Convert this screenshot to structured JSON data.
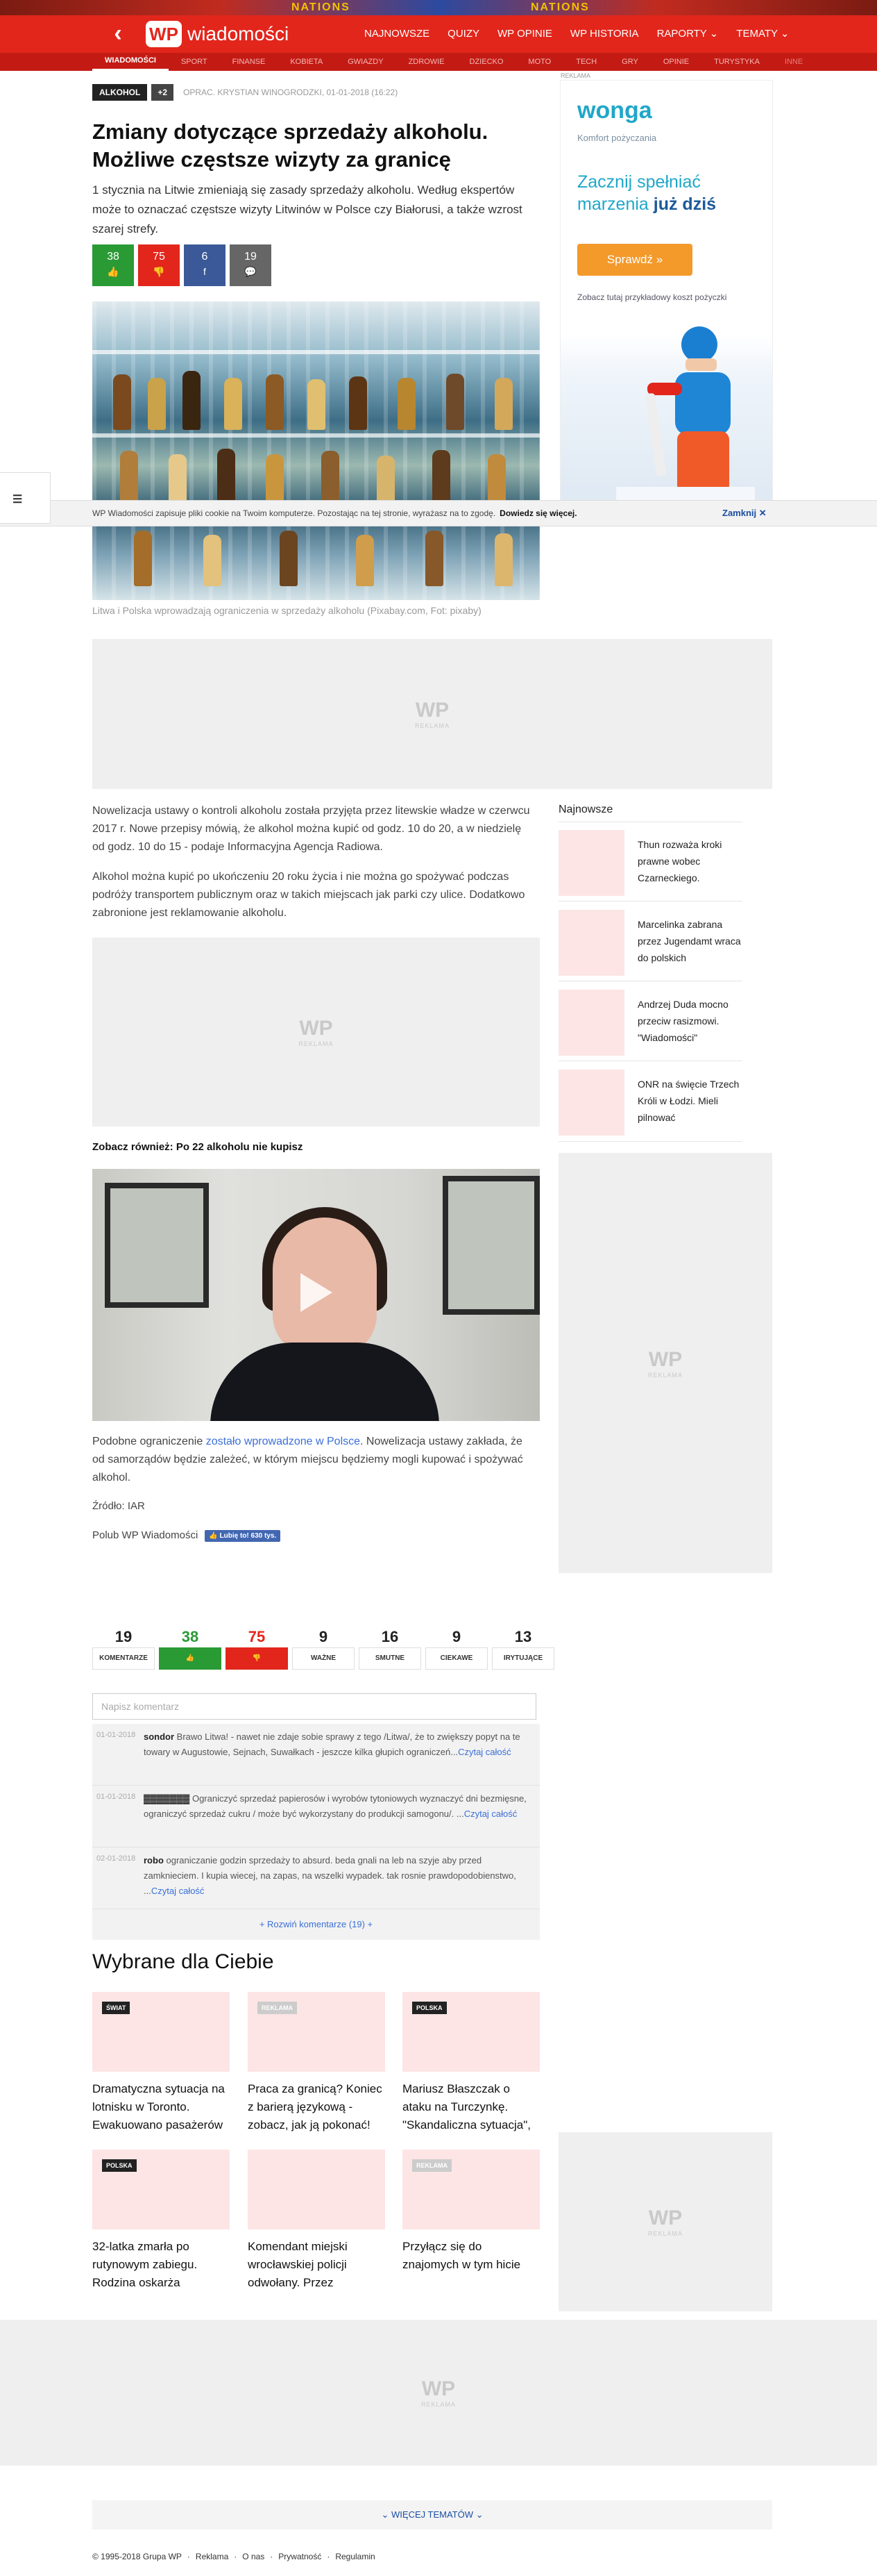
{
  "top_banner": {
    "text_left": "NATIONS",
    "text_right": "NATIONS"
  },
  "header": {
    "back_glyph": "‹",
    "logo_mark": "WP",
    "logo_name": "wiadomości",
    "nav": [
      "NAJNOWSZE",
      "QUIZY",
      "WP OPINIE",
      "WP HISTORIA",
      "RAPORTY ⌄",
      "TEMATY ⌄"
    ]
  },
  "subnav": {
    "items": [
      "WIADOMOŚCI",
      "SPORT",
      "FINANSE",
      "KOBIETA",
      "GWIAZDY",
      "ZDROWIE",
      "DZIECKO",
      "MOTO",
      "TECH",
      "GRY",
      "OPINIE",
      "TURYSTYKA",
      "INNE"
    ],
    "active_index": 0
  },
  "article": {
    "tag": "ALKOHOL",
    "tag_more": "+2",
    "byline": "OPRAC. KRYSTIAN WINOGRODZKI, 01-01-2018 (16:22)",
    "title": "Zmiany dotyczące sprzedaży alkoholu. Możliwe częstsze wizyty za granicę",
    "lead": "1 stycznia na Litwie zmieniają się zasady sprzedaży alkoholu. Według ekspertów może to oznaczać częstsze wizyty Litwinów w Polsce czy Białorusi, a także wzrost szarej strefy.",
    "votes": [
      {
        "count": "38",
        "icon": "👍"
      },
      {
        "count": "75",
        "icon": "👎"
      },
      {
        "count": "6",
        "icon": "f"
      },
      {
        "count": "19",
        "icon": "💬"
      }
    ],
    "caption": "Litwa i Polska wprowadzają ograniczenia w sprzedaży alkoholu (Pixabay.com, Fot: pixaby)",
    "para1": "Nowelizacja ustawy o kontroli alkoholu została przyjęta przez litewskie władze w czerwcu 2017 r. Nowe przepisy mówią, że alkohol można kupić od godz. 10 do 20, a w niedzielę od godz. 10 do 15 - podaje Informacyjna Agencja Radiowa.",
    "para2": "Alkohol można kupić po ukończeniu 20 roku życia i nie można go spożywać podczas podróży transportem publicznym oraz w takich miejscach jak parki czy ulice. Dodatkowo zabronione jest reklamowanie alkoholu.",
    "see_also": "Zobacz również: Po 22 alkoholu nie kupisz",
    "para3_before": "Podobne ograniczenie ",
    "para3_link": "zostało wprowadzone w Polsce",
    "para3_after": ". Nowelizacja ustawy zakłada, że od samorządów będzie zależeć, w którym miejscu będziemy mogli kupować i spożywać alkohol.",
    "source": "Źródło: IAR",
    "like_text": "Polub WP Wiadomości",
    "fb_button": "👍 Lubię to! 630 tys."
  },
  "ads": {
    "label": "REKLAMA",
    "wm_mark": "WP",
    "wm_label": "REKLAMA"
  },
  "wonga": {
    "brand": "wonga",
    "subtitle": "Komfort pożyczania",
    "slogan_1": "Zacznij spełniać marzenia ",
    "slogan_2": "już dziś",
    "cta": "Sprawdź »",
    "note": "Zobacz tutaj przykładowy koszt pożyczki"
  },
  "cookie": {
    "text": "WP Wiadomości zapisuje pliki cookie na Twoim komputerze. Pozostając na tej stronie, wyrażasz na to zgodę.",
    "more": "Dowiedz się więcej.",
    "close": "Zamknij ✕"
  },
  "sidetab_icon": "☰",
  "sidebar": {
    "title": "Najnowsze",
    "items": [
      "Thun rozważa kroki prawne wobec Czarneckiego.",
      "Marcelinka zabrana przez Jugendamt wraca do polskich",
      "Andrzej Duda mocno przeciw rasizmowi. \"Wiadomości\"",
      "ONR na święcie Trzech Króli w Łodzi. Mieli pilnować"
    ]
  },
  "stats": [
    {
      "n": "19",
      "l": "KOMENTARZE",
      "c": ""
    },
    {
      "n": "38",
      "l": "👍",
      "c": "g"
    },
    {
      "n": "75",
      "l": "👎",
      "c": "r"
    },
    {
      "n": "9",
      "l": "WAŻNE",
      "c": ""
    },
    {
      "n": "16",
      "l": "SMUTNE",
      "c": ""
    },
    {
      "n": "9",
      "l": "CIEKAWE",
      "c": ""
    },
    {
      "n": "13",
      "l": "IRYTUJĄCE",
      "c": ""
    }
  ],
  "comments": {
    "placeholder": "Napisz komentarz",
    "items": [
      {
        "date": "01-01-2018",
        "author": "sondor",
        "text": " Brawo Litwa! - nawet nie zdaje sobie sprawy z tego /Litwa/, że to zwiększy popyt na te towary w Augustowie, Sejnach, Suwałkach - jeszcze kilka głupich ograniczeń...",
        "more": "Czytaj całość"
      },
      {
        "date": "01-01-2018",
        "author": "▓▓▓▓▓▓▓",
        "text": " Ograniczyć sprzedaż papierosów i wyrobów tytoniowych wyznaczyć dni bezmięsne, ograniczyć sprzedaż cukru / może być wykorzystany do produkcji samogonu/. ...",
        "more": "Czytaj całość"
      },
      {
        "date": "02-01-2018",
        "author": "robo",
        "text": " ograniczanie godzin sprzedaży to absurd. beda gnali na leb na szyje aby przed zamknieciem. I kupia wiecej, na zapas, na wszelki wypadek. tak rosnie prawdopodobienstwo, ...",
        "more": "Czytaj całość"
      }
    ],
    "expand": "+ Rozwiń komentarze (19) +"
  },
  "recommended": {
    "title": "Wybrane dla Ciebie",
    "cards": [
      {
        "badge": "ŚWIAT",
        "title": "Dramatyczna sytuacja na lotnisku w Toronto. Ewakuowano pasażerów"
      },
      {
        "badge": "REKLAMA",
        "title": "Praca za granicą? Koniec z barierą językową - zobacz, jak ją pokonać!"
      },
      {
        "badge": "POLSKA",
        "title": "Mariusz Błaszczak o ataku na Turczynkę. \"Skandaliczna sytuacja\","
      },
      {
        "badge": "POLSKA",
        "title": "32-latka zmarła po rutynowym zabiegu. Rodzina oskarża"
      },
      {
        "badge": "",
        "title": "Komendant miejski wrocławskiej policji odwołany. Przez"
      },
      {
        "badge": "REKLAMA",
        "title": "Przyłącz się do znajomych w tym hicie"
      }
    ]
  },
  "footer": {
    "more_topics": "⌄ WIĘCEJ TEMATÓW ⌄",
    "links": [
      "© 1995-2018 Grupa WP",
      "·",
      "Reklama",
      "·",
      "O nas",
      "·",
      "Prywatność",
      "·",
      "Regulamin"
    ]
  }
}
